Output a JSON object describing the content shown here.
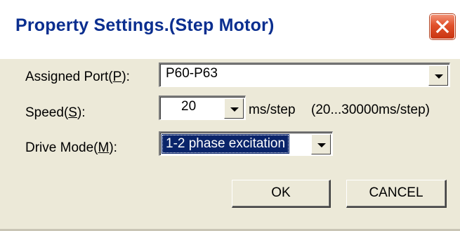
{
  "window": {
    "title": "Property Settings.(Step Motor)",
    "close_icon": "close-icon"
  },
  "form": {
    "assigned_port": {
      "label_prefix": "Assigned Port(",
      "accel_key": "P",
      "label_suffix": "):",
      "value": "P60-P63"
    },
    "speed": {
      "label_prefix": "Speed(",
      "accel_key": "S",
      "label_suffix": "):",
      "value": "20",
      "unit": "ms/step",
      "range_hint": "(20...30000ms/step)"
    },
    "drive_mode": {
      "label_prefix": "Drive Mode(",
      "accel_key": "M",
      "label_suffix": "):",
      "value": "1-2 phase excitation"
    }
  },
  "buttons": {
    "ok_label": "OK",
    "cancel_label": "CANCEL"
  },
  "colors": {
    "dialog_bg": "#ece9d8",
    "title_text": "#0a2e8f",
    "selection_bg": "#0a246a",
    "close_button": "#e0502a"
  }
}
